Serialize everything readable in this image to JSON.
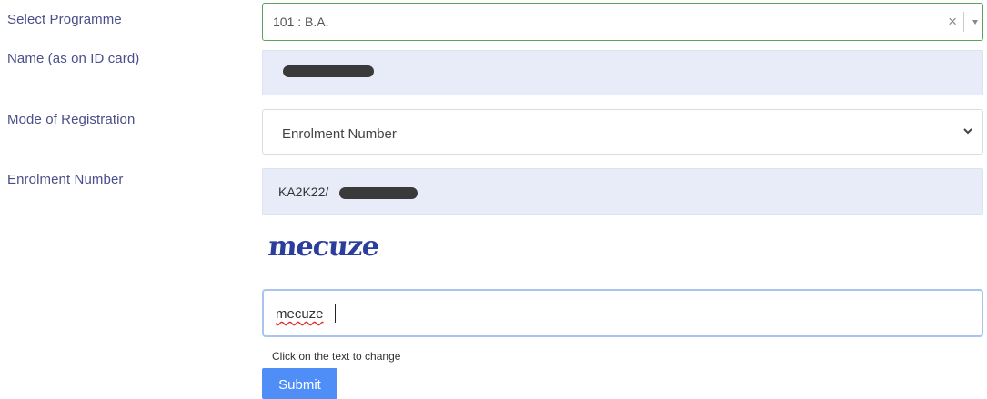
{
  "form": {
    "programme": {
      "label": "Select Programme",
      "value": "101 : B.A.",
      "clear_glyph": "×"
    },
    "name": {
      "label": "Name (as on ID card)",
      "value": ""
    },
    "mode": {
      "label": "Mode of Registration",
      "value": "Enrolment Number"
    },
    "enrolment": {
      "label": "Enrolment Number",
      "value": "KA2K22/"
    },
    "captcha": {
      "image_text": "mecuze",
      "input_value": "mecuze",
      "hint": "Click on the text to change"
    },
    "submit_label": "Submit"
  },
  "colors": {
    "label": "#4a4e8a",
    "readonly_bg": "#e8ecf8",
    "submit_bg": "#4f8ef7",
    "captcha": "#2c3e9c",
    "focus_border": "#a9c5ee",
    "select_border": "#5aa35c"
  },
  "icons": {
    "clear": "close-icon",
    "dropdown": "chevron-down-icon"
  }
}
